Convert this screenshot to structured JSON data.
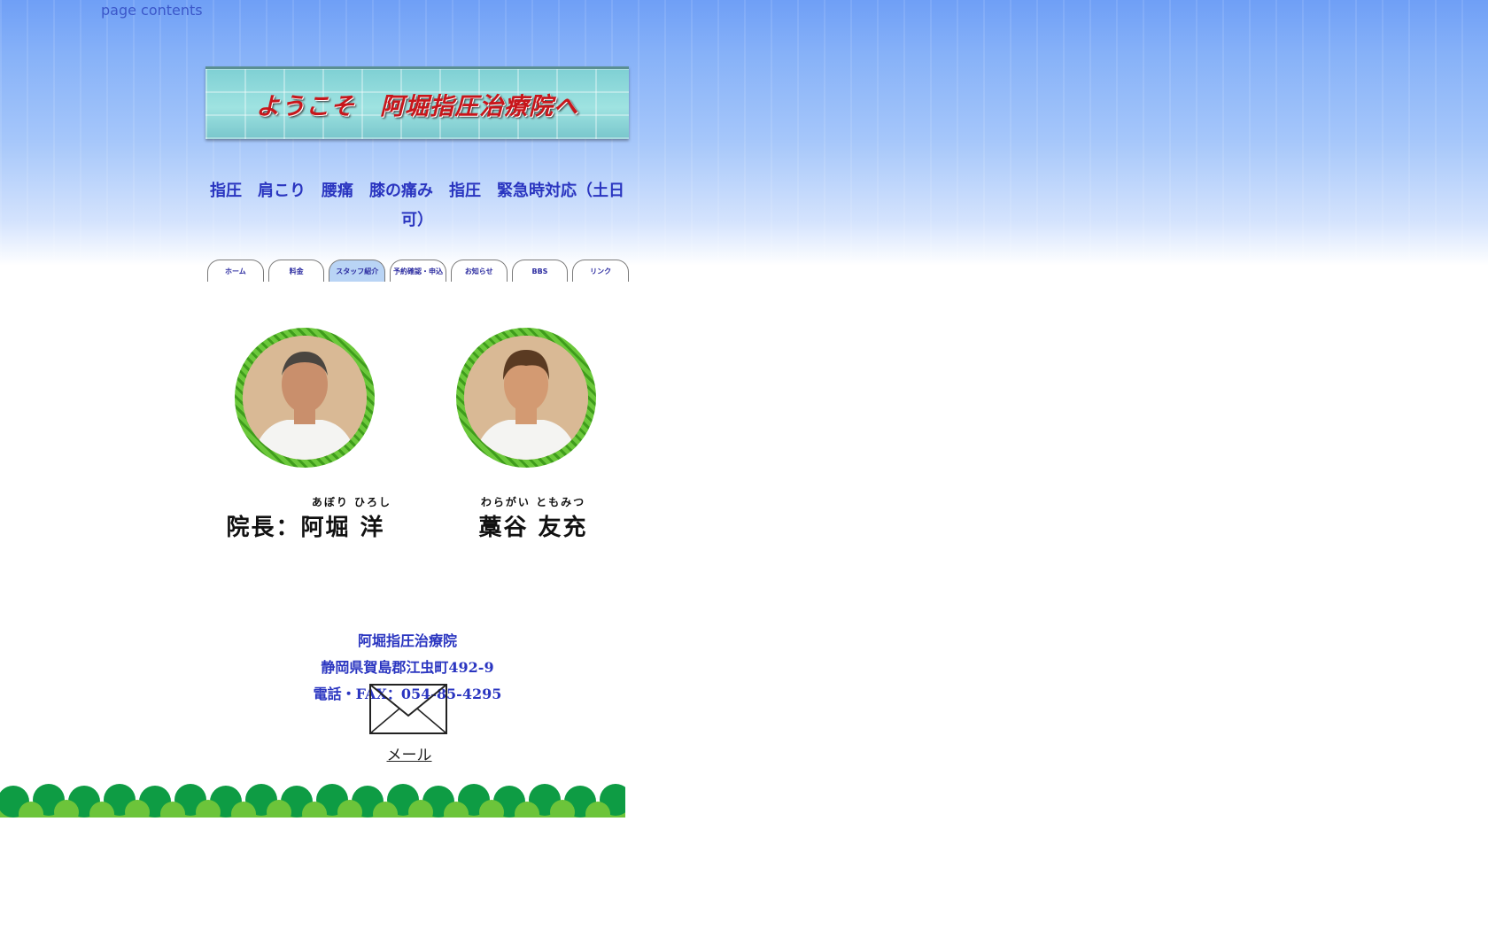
{
  "skip_link": "page contents",
  "banner": {
    "title": "ようこそ　阿堀指圧治療院へ"
  },
  "tagline": "指圧　肩こり　腰痛　膝の痛み　指圧　緊急時対応（土日可）",
  "nav": {
    "tabs": [
      {
        "label": "ホーム",
        "active": false
      },
      {
        "label": "料金",
        "active": false
      },
      {
        "label": "スタッフ紹介",
        "active": true
      },
      {
        "label": "予約確認・申込",
        "active": false
      },
      {
        "label": "お知らせ",
        "active": false
      },
      {
        "label": "BBS",
        "active": false
      },
      {
        "label": "リンク",
        "active": false
      }
    ]
  },
  "staff": [
    {
      "ruby": "あぼり ひろし",
      "name": "院長：阿堀 洋"
    },
    {
      "ruby": "わらがい ともみつ",
      "name": "藁谷 友充"
    }
  ],
  "footer": {
    "clinic_name": "阿堀指圧治療院",
    "address": "静岡県賀島郡江虫町492-9",
    "phone": "電話・FAX：054-85-4295",
    "mail_label": "メール"
  },
  "colors": {
    "sky_top": "#6f9ff6",
    "accent_text": "#2a35c0",
    "banner_title": "#c8161b",
    "active_tab": "#b9d4f5",
    "hedge_dark": "#0e9c44",
    "hedge_light": "#6cc43a"
  }
}
